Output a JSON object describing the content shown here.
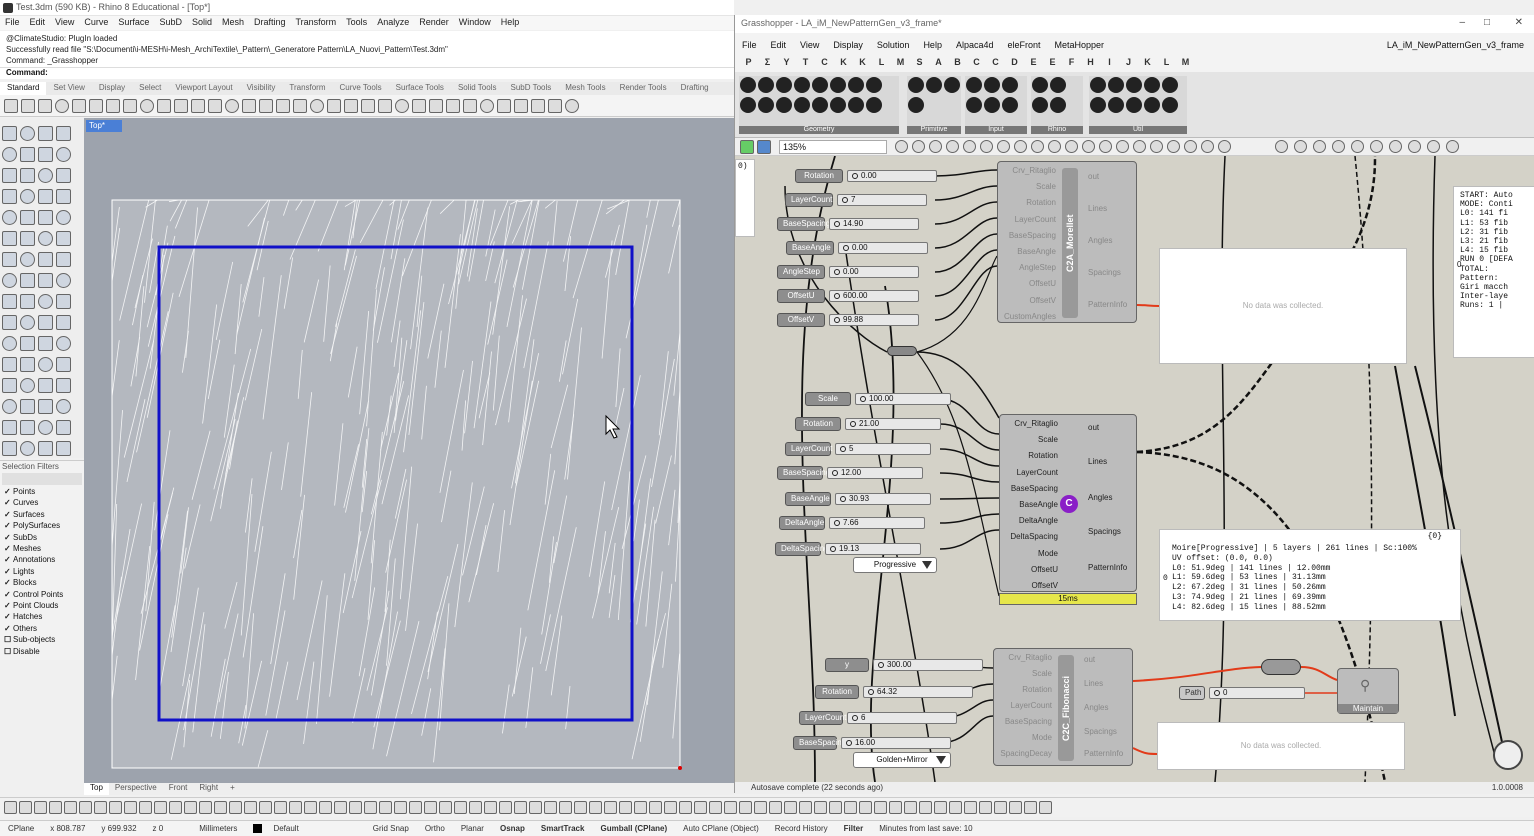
{
  "rhino": {
    "title": "Test.3dm (590 KB) - Rhino 8 Educational - [Top*]",
    "menu": [
      "File",
      "Edit",
      "View",
      "Curve",
      "Surface",
      "SubD",
      "Solid",
      "Mesh",
      "Drafting",
      "Transform",
      "Tools",
      "Analyze",
      "Render",
      "Window",
      "Help"
    ],
    "history": [
      "@ClimateStudio: PlugIn loaded",
      "Successfully read file \"S:\\Documenti\\i-MESH\\i-Mesh_ArchiTextile\\_Pattern\\_Generatore Pattern\\LA_Nuovi_Pattern\\Test.3dm\"",
      "Command: _Grasshopper"
    ],
    "command_label": "Command:",
    "toolbar_tabs": [
      "Standard",
      "Set View",
      "Display",
      "Select",
      "Viewport Layout",
      "Visibility",
      "Transform",
      "Curve Tools",
      "Surface Tools",
      "Solid Tools",
      "SubD Tools",
      "Mesh Tools",
      "Render Tools",
      "Drafting"
    ],
    "viewport_name": "Top*",
    "viewport_tabs": [
      "Top",
      "Perspective",
      "Front",
      "Right"
    ],
    "selection_filters": {
      "title": "Selection Filters",
      "items": [
        {
          "label": "Points",
          "checked": true
        },
        {
          "label": "Curves",
          "checked": true
        },
        {
          "label": "Surfaces",
          "checked": true
        },
        {
          "label": "PolySurfaces",
          "checked": true
        },
        {
          "label": "SubDs",
          "checked": true
        },
        {
          "label": "Meshes",
          "checked": true
        },
        {
          "label": "Annotations",
          "checked": true
        },
        {
          "label": "Lights",
          "checked": true
        },
        {
          "label": "Blocks",
          "checked": true
        },
        {
          "label": "Control Points",
          "checked": true
        },
        {
          "label": "Point Clouds",
          "checked": true
        },
        {
          "label": "Hatches",
          "checked": true
        },
        {
          "label": "Others",
          "checked": true
        },
        {
          "label": "Sub-objects",
          "checked": false
        },
        {
          "label": "Disable",
          "checked": false
        }
      ]
    },
    "status": {
      "cplane": "CPlane",
      "x": "x 808.787",
      "y": "y 699.932",
      "z": "z 0",
      "units": "Millimeters",
      "layer": "Default",
      "grid_snap": "Grid Snap",
      "ortho": "Ortho",
      "planar": "Planar",
      "osnap": "Osnap",
      "smarttrack": "SmartTrack",
      "gumball": "Gumball (CPlane)",
      "autocplane": "Auto CPlane (Object)",
      "record": "Record History",
      "filter": "Filter",
      "minutes": "Minutes from last save: 10"
    },
    "colors": {
      "frame": "#1010c8",
      "hatch": "#ffffff",
      "viewport_bg": "#9da3ad"
    }
  },
  "gh": {
    "title": "Grasshopper - LA_iM_NewPatternGen_v3_frame*",
    "menu": [
      "File",
      "Edit",
      "View",
      "Display",
      "Solution",
      "Help",
      "Alpaca4d",
      "eleFront",
      "MetaHopper"
    ],
    "doc_name": "LA_iM_NewPatternGen_v3_frame",
    "categories": [
      "P",
      "Σ",
      "Y",
      "T",
      "C",
      "K",
      "K",
      "L",
      "M",
      "S",
      "A",
      "B",
      "C",
      "C",
      "D",
      "E",
      "E",
      "F",
      "H",
      "I",
      "J",
      "K",
      "L",
      "M"
    ],
    "groups": [
      "Geometry",
      "Primitive",
      "Input",
      "Rhino",
      "Util"
    ],
    "zoom": "135%",
    "status": "Autosave complete (22 seconds ago)",
    "version": "1.0.0008",
    "sliders_a": [
      {
        "name": "Rotation",
        "value": "0.00"
      },
      {
        "name": "LayerCount",
        "value": "7"
      },
      {
        "name": "BaseSpacing",
        "value": "14.90"
      },
      {
        "name": "BaseAngle",
        "value": "0.00"
      },
      {
        "name": "AngleStep",
        "value": "0.00"
      },
      {
        "name": "OffsetU",
        "value": "600.00"
      },
      {
        "name": "OffsetV",
        "value": "99.88"
      }
    ],
    "comp_a": {
      "title": "C2A_Morellet",
      "inputs": [
        "Crv_Ritaglio",
        "Scale",
        "Rotation",
        "LayerCount",
        "BaseSpacing",
        "BaseAngle",
        "AngleStep",
        "OffsetU",
        "OffsetV",
        "CustomAngles"
      ],
      "outputs": [
        "out",
        "Lines",
        "Angles",
        "Spacings",
        "PatternInfo"
      ]
    },
    "panel_a": "No data was collected.",
    "sliders_b": [
      {
        "name": "Scale",
        "value": "100.00"
      },
      {
        "name": "Rotation",
        "value": "21.00"
      },
      {
        "name": "LayerCount",
        "value": "5"
      },
      {
        "name": "BaseSpacing",
        "value": "12.00"
      },
      {
        "name": "BaseAngle",
        "value": "30.93"
      },
      {
        "name": "DeltaAngle",
        "value": "7.66"
      },
      {
        "name": "DeltaSpacing",
        "value": "19.13"
      }
    ],
    "select_b": "Progressive",
    "comp_b": {
      "inputs": [
        "Crv_Ritaglio",
        "Scale",
        "Rotation",
        "LayerCount",
        "BaseSpacing",
        "BaseAngle",
        "DeltaAngle",
        "DeltaSpacing",
        "Mode",
        "OffsetU",
        "OffsetV"
      ],
      "outputs": [
        "out",
        "Lines",
        "Angles",
        "Spacings",
        "PatternInfo"
      ],
      "time": "15ms"
    },
    "panel_b": {
      "header": "{0}",
      "index": "0",
      "lines": [
        "Moire[Progressive] | 5 layers | 261 lines | Sc:100%",
        "UV offset: (0.0, 0.0)",
        "L0: 51.9deg | 141 lines | 12.00mm",
        "L1: 59.6deg | 53 lines | 31.13mm",
        "L2: 67.2deg | 31 lines | 50.26mm",
        "L3: 74.9deg | 21 lines | 69.39mm",
        "L4: 82.6deg | 15 lines | 88.52mm"
      ]
    },
    "panel_right": [
      "START: Auto",
      "MODE: Conti",
      "L0: 141 fi",
      "L1: 53 fib",
      "L2: 31 fib",
      "L3: 21 fib",
      "L4: 15 fib",
      "RUN 0 [DEFA",
      "TOTAL:",
      "Pattern:",
      "Giri macch",
      "Inter-laye",
      "Runs: 1 |"
    ],
    "panel_right_hdr": "0",
    "panel_left_hdr": "0)",
    "sliders_c": [
      {
        "name": "y",
        "value": "300.00"
      },
      {
        "name": "Rotation",
        "value": "64.32"
      },
      {
        "name": "LayerCount",
        "value": "6"
      },
      {
        "name": "BaseSpacing",
        "value": "16.00"
      }
    ],
    "select_c": "Golden+Mirror",
    "comp_c": {
      "title": "C2C_Fibonacci",
      "inputs": [
        "Crv_Ritaglio",
        "Scale",
        "Rotation",
        "LayerCount",
        "BaseSpacing",
        "Mode",
        "SpacingDecay"
      ],
      "outputs": [
        "out",
        "Lines",
        "Angles",
        "Spacings",
        "PatternInfo"
      ]
    },
    "path": {
      "name": "Path",
      "value": "0"
    },
    "maintain": "Maintain",
    "panel_c": "No data was collected."
  }
}
